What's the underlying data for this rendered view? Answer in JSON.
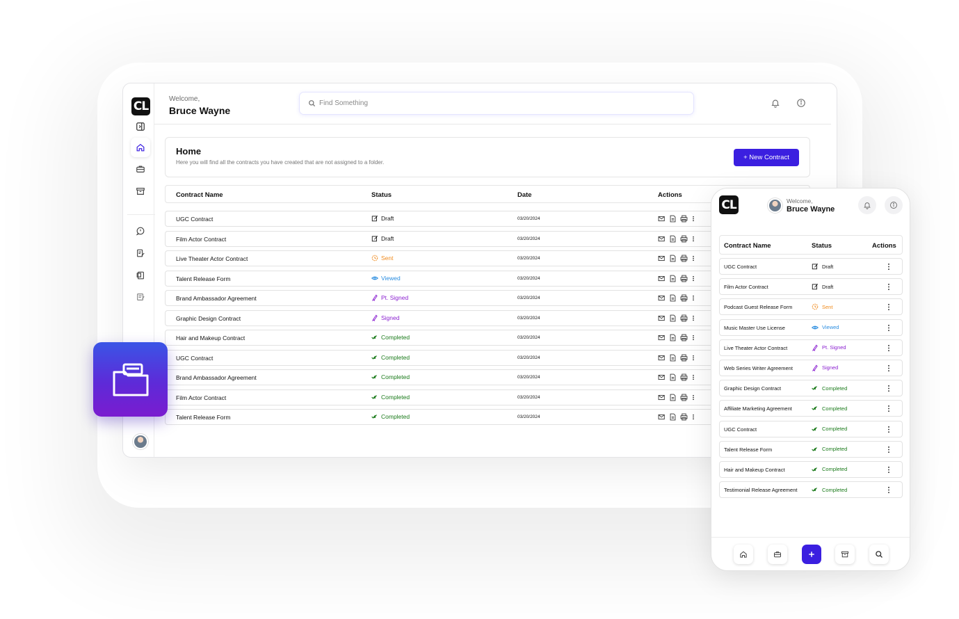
{
  "desktop": {
    "logo": "CL",
    "welcome_label": "Welcome,",
    "user_name": "Bruce Wayne",
    "search_placeholder": "Find Something",
    "home": {
      "title": "Home",
      "subtitle": "Here you will find all the contracts you have created that are not assigned to a folder.",
      "new_contract_label": "+ New Contract"
    },
    "columns": {
      "name": "Contract Name",
      "status": "Status",
      "date": "Date",
      "actions": "Actions"
    },
    "rows": [
      {
        "name": "UGC Contract",
        "status": "Draft",
        "date": "03/20/2024"
      },
      {
        "name": "Film Actor Contract",
        "status": "Draft",
        "date": "03/20/2024"
      },
      {
        "name": "Live Theater Actor Contract",
        "status": "Sent",
        "date": "03/20/2024"
      },
      {
        "name": "Talent Release Form",
        "status": "Viewed",
        "date": "03/20/2024"
      },
      {
        "name": "Brand Ambassador Agreement",
        "status": "Pt. Signed",
        "date": "03/20/2024"
      },
      {
        "name": "Graphic Design Contract",
        "status": "Signed",
        "date": "03/20/2024"
      },
      {
        "name": "Hair and Makeup Contract",
        "status": "Completed",
        "date": "03/20/2024"
      },
      {
        "name": "UGC Contract",
        "status": "Completed",
        "date": "03/20/2024"
      },
      {
        "name": "Brand Ambassador Agreement",
        "status": "Completed",
        "date": "03/20/2024"
      },
      {
        "name": "Film Actor Contract",
        "status": "Completed",
        "date": "03/20/2024"
      },
      {
        "name": "Talent Release Form",
        "status": "Completed",
        "date": "03/20/2024"
      }
    ]
  },
  "mobile": {
    "logo": "CL",
    "welcome_label": "Welcome,",
    "user_name": "Bruce Wayne",
    "columns": {
      "name": "Contract Name",
      "status": "Status",
      "actions": "Actions"
    },
    "rows": [
      {
        "name": "UGC Contract",
        "status": "Draft"
      },
      {
        "name": "Film Actor Contract",
        "status": "Draft"
      },
      {
        "name": "Podcast Guest Release Form",
        "status": "Sent"
      },
      {
        "name": "Music Master Use License",
        "status": "Viewed"
      },
      {
        "name": "Live Theater Actor Contract",
        "status": "Pt. Signed"
      },
      {
        "name": "Web Series Writer Agreement",
        "status": "Signed"
      },
      {
        "name": "Graphic Design Contract",
        "status": "Completed"
      },
      {
        "name": "Affiliate Marketing Agreement",
        "status": "Completed"
      },
      {
        "name": "UGC Contract",
        "status": "Completed"
      },
      {
        "name": "Talent Release Form",
        "status": "Completed"
      },
      {
        "name": "Hair and Makeup Contract",
        "status": "Completed"
      },
      {
        "name": "Testimonial Release Agreement",
        "status": "Completed"
      }
    ],
    "tabs": [
      "home-icon",
      "briefcase-icon",
      "plus-icon",
      "archive-icon",
      "search-icon"
    ]
  },
  "colors": {
    "accent": "#3b1fe0",
    "draft": "#111111",
    "sent": "#f08a1c",
    "viewed": "#2a8de0",
    "signed": "#8a1fd0",
    "completed": "#1a7a1a"
  }
}
